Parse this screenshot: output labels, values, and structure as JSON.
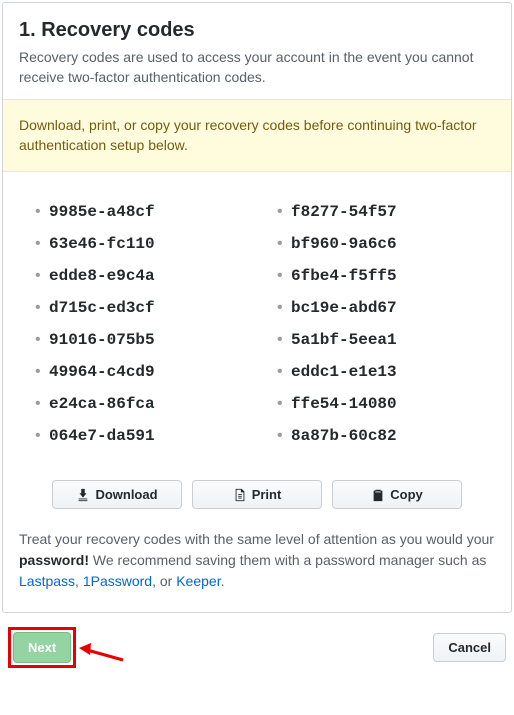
{
  "header": {
    "title": "1. Recovery codes",
    "description": "Recovery codes are used to access your account in the event you cannot receive two-factor authentication codes."
  },
  "alert": {
    "text": "Download, print, or copy your recovery codes before continuing two-factor authentication setup below."
  },
  "codes": {
    "left": [
      "9985e-a48cf",
      "63e46-fc110",
      "edde8-e9c4a",
      "d715c-ed3cf",
      "91016-075b5",
      "49964-c4cd9",
      "e24ca-86fca",
      "064e7-da591"
    ],
    "right": [
      "f8277-54f57",
      "bf960-9a6c6",
      "6fbe4-f5ff5",
      "bc19e-abd67",
      "5a1bf-5eea1",
      "eddc1-e1e13",
      "ffe54-14080",
      "8a87b-60c82"
    ]
  },
  "actions": {
    "download": "Download",
    "print": "Print",
    "copy": "Copy"
  },
  "footer": {
    "prefix": "Treat your recovery codes with the same level of attention as you would your ",
    "bold": "password!",
    "mid": " We recommend saving them with a password manager such as ",
    "lastpass": "Lastpass",
    "sep1": ", ",
    "onepassword": "1Password",
    "sep2": ", or ",
    "keeper": "Keeper",
    "end": "."
  },
  "nav": {
    "next": "Next",
    "cancel": "Cancel"
  }
}
